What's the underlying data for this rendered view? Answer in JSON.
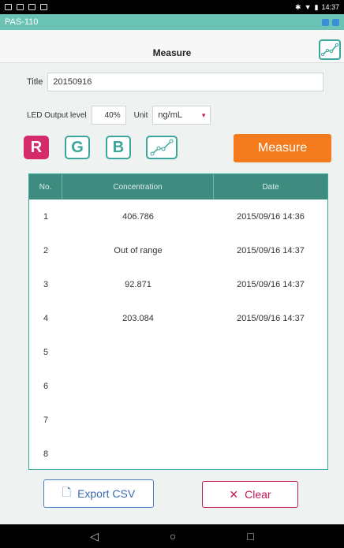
{
  "status_bar": {
    "time": "14:37"
  },
  "app": {
    "name": "PAS-110"
  },
  "header": {
    "title": "Measure",
    "chart_icon": "scatter-chart-icon"
  },
  "form": {
    "title_label": "Title",
    "title_value": "20150916",
    "led_label": "LED Output level",
    "led_value": "40%",
    "unit_label": "Unit",
    "unit_value": "ng/mL"
  },
  "channels": {
    "r": "R",
    "g": "G",
    "b": "B"
  },
  "measure_label": "Measure",
  "table": {
    "headers": {
      "no": "No.",
      "concentration": "Concentration",
      "date": "Date"
    },
    "rows": [
      {
        "no": "1",
        "concentration": "406.786",
        "date": "2015/09/16 14:36"
      },
      {
        "no": "2",
        "concentration": "Out of range",
        "date": "2015/09/16 14:37"
      },
      {
        "no": "3",
        "concentration": "92.871",
        "date": "2015/09/16 14:37"
      },
      {
        "no": "4",
        "concentration": "203.084",
        "date": "2015/09/16 14:37"
      },
      {
        "no": "5",
        "concentration": "",
        "date": ""
      },
      {
        "no": "6",
        "concentration": "",
        "date": ""
      },
      {
        "no": "7",
        "concentration": "",
        "date": ""
      },
      {
        "no": "8",
        "concentration": "",
        "date": ""
      }
    ]
  },
  "actions": {
    "export_label": "Export CSV",
    "clear_label": "Clear"
  },
  "colors": {
    "accent": "#3aa79a",
    "measure": "#f47b1e",
    "red_channel": "#d62b6a",
    "export": "#3a6cb4",
    "clear": "#c2185b"
  }
}
